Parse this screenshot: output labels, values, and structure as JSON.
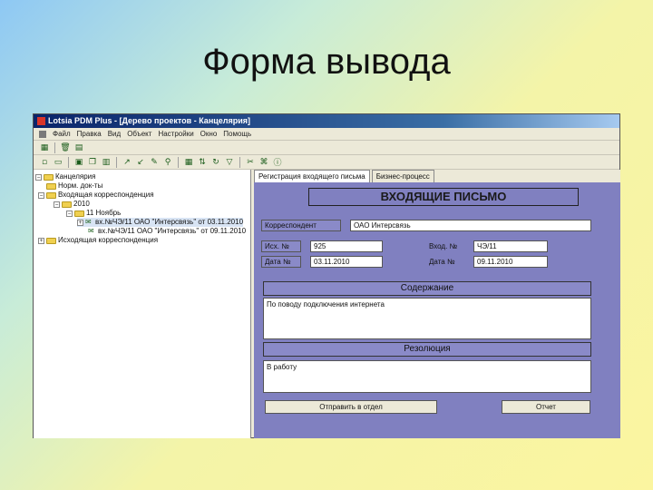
{
  "slide": {
    "title": "Форма вывода"
  },
  "window": {
    "title": "Lotsia PDM Plus - [Дерево проектов - Канцелярия]",
    "menu": [
      "Файл",
      "Правка",
      "Вид",
      "Объект",
      "Настройки",
      "Окно",
      "Помощь"
    ]
  },
  "tree": {
    "items": [
      {
        "label": "Канцелярия",
        "toggle": "−"
      },
      {
        "label": "Норм. док-ты",
        "toggle": ""
      },
      {
        "label": "Входящая корреспонденция",
        "toggle": "−"
      },
      {
        "label": "2010",
        "toggle": "−"
      },
      {
        "label": "11 Ноябрь",
        "toggle": "−"
      },
      {
        "label": "вх.№ЧЭ/11 ОАО \"Интерсвязь\" от 03.11.2010",
        "toggle": "+"
      },
      {
        "label": "вх.№ЧЭ/11 ОАО \"Интерсвязь\" от 09.11.2010",
        "toggle": ""
      },
      {
        "label": "Исходящая корреспонденция",
        "toggle": "+"
      }
    ]
  },
  "form": {
    "tabs": [
      "Регистрация входящего письма",
      "Бизнес-процесс"
    ],
    "title": "ВХОДЯЩИЕ ПИСЬМО",
    "correspondent_label": "Корреспондент",
    "correspondent_value": "ОАО Интерсвязь",
    "in_num_label": "Исх. №",
    "in_num_value": "925",
    "in_date_label": "Дата №",
    "in_date_value": "03.11.2010",
    "reg_num_label": "Вход. №",
    "reg_num_value": "ЧЭ/11",
    "reg_date_label": "Дата №",
    "reg_date_value": "09.11.2010",
    "content_header": "Содержание",
    "content_value": "По поводу подключения интернета",
    "resolution_header": "Резолюция",
    "resolution_value": "В работу",
    "send_button": "Отправить в отдел",
    "report_button": "Отчет"
  }
}
